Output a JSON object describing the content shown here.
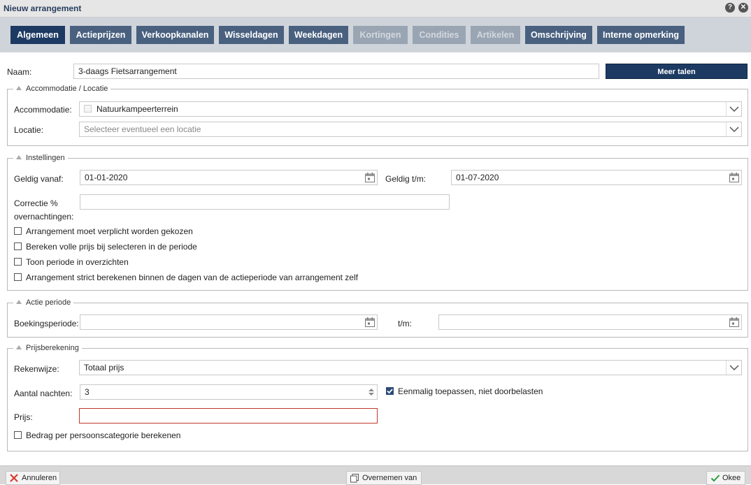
{
  "window": {
    "title": "Nieuw arrangement"
  },
  "tabs": [
    {
      "label": "Algemeen",
      "state": "active"
    },
    {
      "label": "Actieprijzen",
      "state": "normal"
    },
    {
      "label": "Verkoopkanalen",
      "state": "normal"
    },
    {
      "label": "Wisseldagen",
      "state": "normal"
    },
    {
      "label": "Weekdagen",
      "state": "normal"
    },
    {
      "label": "Kortingen",
      "state": "disabled"
    },
    {
      "label": "Condities",
      "state": "disabled"
    },
    {
      "label": "Artikelen",
      "state": "disabled"
    },
    {
      "label": "Omschrijving",
      "state": "normal"
    },
    {
      "label": "Interne opmerking",
      "state": "normal"
    }
  ],
  "naam": {
    "label": "Naam:",
    "value": "3-daags Fietsarrangement",
    "more_languages": "Meer talen"
  },
  "accommodatie_section": {
    "legend": "Accommodatie / Locatie",
    "accommodatie_label": "Accommodatie:",
    "accommodatie_value": "Natuurkampeerterrein",
    "locatie_label": "Locatie:",
    "locatie_placeholder": "Selecteer eventueel een locatie"
  },
  "instellingen": {
    "legend": "Instellingen",
    "geldig_vanaf_label": "Geldig vanaf:",
    "geldig_vanaf_value": "01-01-2020",
    "geldig_tm_label": "Geldig t/m:",
    "geldig_tm_value": "01-07-2020",
    "correctie_label_1": "Correctie %",
    "correctie_label_2": "overnachtingen:",
    "correctie_value": "",
    "checkboxes": [
      {
        "label": "Arrangement moet verplicht worden gekozen",
        "checked": false
      },
      {
        "label": "Bereken volle prijs bij selecteren in de periode",
        "checked": false
      },
      {
        "label": "Toon periode in overzichten",
        "checked": false
      },
      {
        "label": "Arrangement strict berekenen binnen de dagen van de actieperiode van arrangement zelf",
        "checked": false
      }
    ]
  },
  "actie_periode": {
    "legend": "Actie periode",
    "boekingsperiode_label": "Boekingsperiode:",
    "boekingsperiode_value": "",
    "tm_label": "t/m:",
    "tm_value": ""
  },
  "prijsberekening": {
    "legend": "Prijsberekening",
    "rekenwijze_label": "Rekenwijze:",
    "rekenwijze_value": "Totaal prijs",
    "aantal_nachten_label": "Aantal nachten:",
    "aantal_nachten_value": "3",
    "eenmalig_label": "Eenmalig toepassen, niet doorbelasten",
    "eenmalig_checked": true,
    "prijs_label": "Prijs:",
    "prijs_value": "",
    "bedrag_label": "Bedrag per persoonscategorie berekenen",
    "bedrag_checked": false
  },
  "footer": {
    "cancel_label": "Annuleren",
    "copy_label": "Overnemen van",
    "ok_label": "Okee"
  },
  "colors": {
    "primary": "#1d3a63",
    "tab": "#49607f",
    "tab_disabled": "#9aa5b4",
    "error_border": "#c0392b"
  }
}
